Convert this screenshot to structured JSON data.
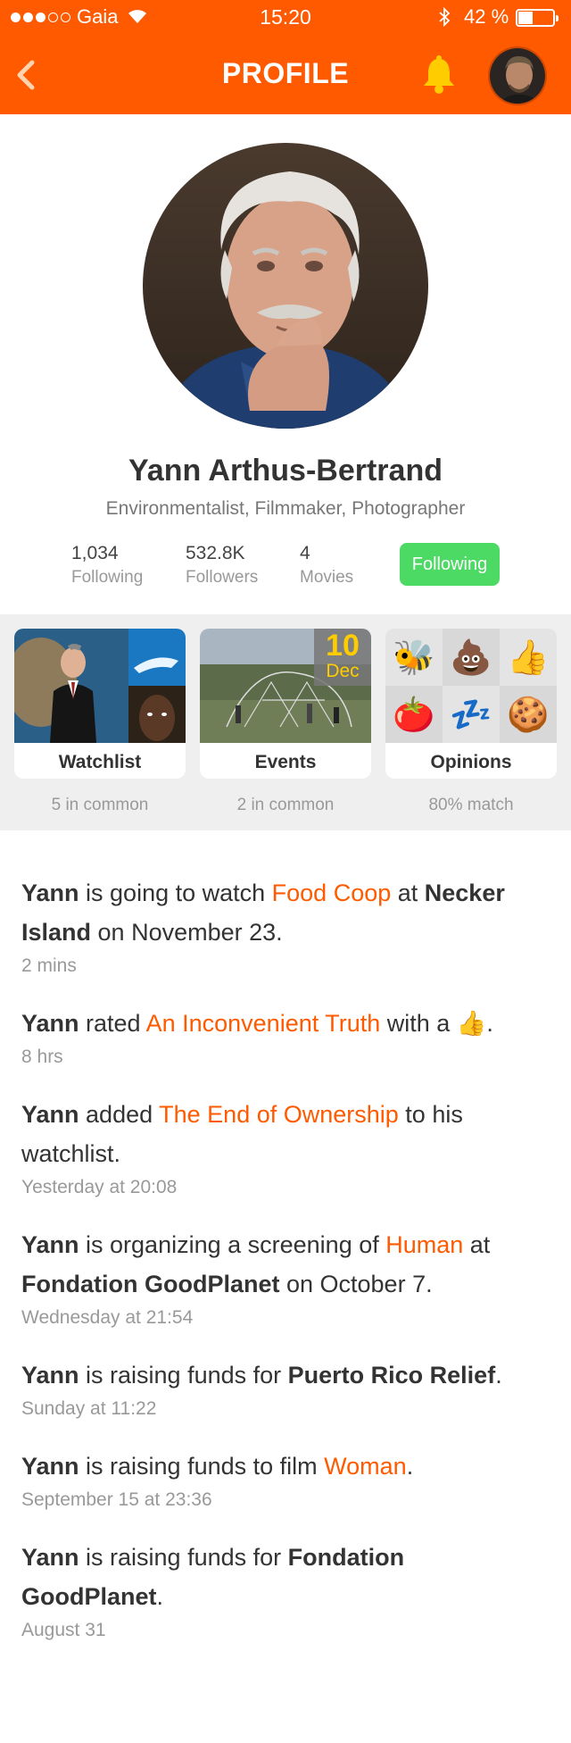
{
  "status_bar": {
    "carrier": "Gaia",
    "time": "15:20",
    "battery_pct": "42 %",
    "battery_level": 0.42
  },
  "header": {
    "title": "PROFILE"
  },
  "profile": {
    "name": "Yann Arthus-Bertrand",
    "tagline": "Environmentalist, Filmmaker, Photographer",
    "stats": [
      {
        "num": "1,034",
        "label": "Following"
      },
      {
        "num": "532.8K",
        "label": "Followers"
      },
      {
        "num": "4",
        "label": "Movies"
      }
    ],
    "follow_button": "Following"
  },
  "cards": [
    {
      "label": "Watchlist",
      "sub": "5 in common"
    },
    {
      "label": "Events",
      "sub": "2 in common",
      "badge_day": "10",
      "badge_month": "Dec"
    },
    {
      "label": "Opinions",
      "sub": "80% match",
      "emojis": [
        "🐝",
        "💩",
        "👍",
        "🍅",
        "💤",
        "🍪"
      ]
    }
  ],
  "feed": [
    {
      "parts": [
        [
          "b",
          "Yann"
        ],
        [
          "t",
          " is going to watch "
        ],
        [
          "h",
          "Food Coop"
        ],
        [
          "t",
          " at "
        ],
        [
          "b",
          "Necker Island"
        ],
        [
          "t",
          " on November 23."
        ]
      ],
      "time": "2 mins"
    },
    {
      "parts": [
        [
          "b",
          "Yann"
        ],
        [
          "t",
          " rated "
        ],
        [
          "h",
          "An Inconvenient Truth"
        ],
        [
          "t",
          " with a 👍."
        ]
      ],
      "time": "8 hrs"
    },
    {
      "parts": [
        [
          "b",
          "Yann"
        ],
        [
          "t",
          " added "
        ],
        [
          "h",
          "The End of Ownership"
        ],
        [
          "t",
          " to his watchlist."
        ]
      ],
      "time": "Yesterday at 20:08"
    },
    {
      "parts": [
        [
          "b",
          "Yann"
        ],
        [
          "t",
          " is organizing a screening of "
        ],
        [
          "h",
          "Human"
        ],
        [
          "t",
          " at "
        ],
        [
          "b",
          "Fondation GoodPlanet"
        ],
        [
          "t",
          " on October 7."
        ]
      ],
      "time": "Wednesday at 21:54"
    },
    {
      "parts": [
        [
          "b",
          "Yann"
        ],
        [
          "t",
          " is raising funds for "
        ],
        [
          "b",
          "Puerto Rico Relief"
        ],
        [
          "t",
          "."
        ]
      ],
      "time": "Sunday at 11:22"
    },
    {
      "parts": [
        [
          "b",
          "Yann"
        ],
        [
          "t",
          " is raising funds to film "
        ],
        [
          "h",
          "Woman"
        ],
        [
          "t",
          "."
        ]
      ],
      "time": "September 15 at 23:36"
    },
    {
      "parts": [
        [
          "b",
          "Yann"
        ],
        [
          "t",
          " is raising funds for "
        ],
        [
          "b",
          "Fondation GoodPlanet"
        ],
        [
          "t",
          "."
        ]
      ],
      "time": "August 31"
    }
  ],
  "colors": {
    "accent": "#ff5a00",
    "follow_green": "#4cd964",
    "bell_yellow": "#ffcc00"
  }
}
